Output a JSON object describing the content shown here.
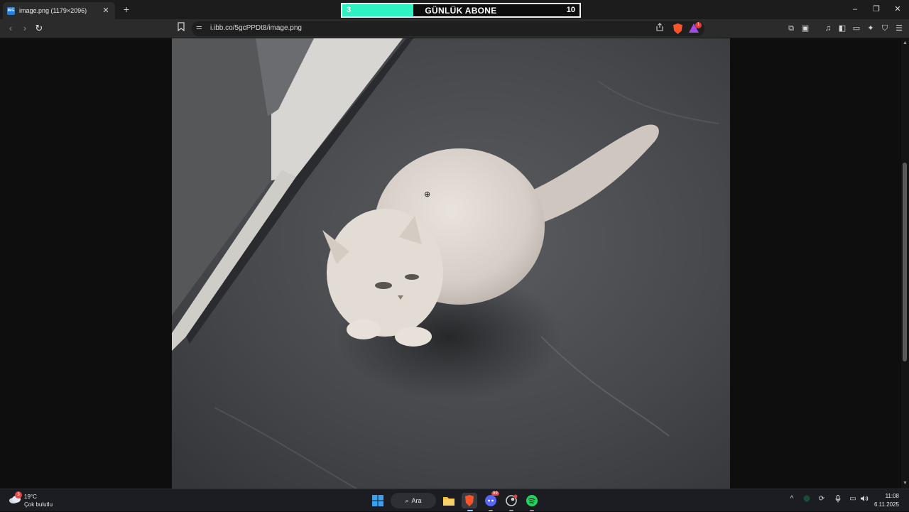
{
  "tab": {
    "title": "image.png (1179×2096)",
    "favicon_label": "IMG",
    "close": "✕",
    "new_tab": "+"
  },
  "subscriber_goal": {
    "current": "3",
    "label": "GÜNLÜK ABONE",
    "goal": "10",
    "progress": 0.3,
    "accent": "#2ef2c2"
  },
  "window_controls": {
    "minimize": "–",
    "restore": "❐",
    "close": "✕"
  },
  "nav": {
    "back": "‹",
    "forward": "›",
    "reload": "↻"
  },
  "address": {
    "site_info_icon": "⚌",
    "url": "i.ibb.co/5gcPPDt8/image.png"
  },
  "brave": {
    "shield_color": "#fb542b",
    "rewards_color": "#a34ae0",
    "rewards_badge": "1"
  },
  "toolbar_icons": [
    {
      "name": "extensions-icon",
      "glyph": "⧉"
    },
    {
      "name": "screenshot-icon",
      "glyph": "▣"
    },
    {
      "name": "media-icon",
      "glyph": "♫"
    },
    {
      "name": "sidebar-icon",
      "glyph": "◧"
    },
    {
      "name": "wallet-icon",
      "glyph": "▭"
    },
    {
      "name": "leo-ai-icon",
      "glyph": "✦"
    },
    {
      "name": "vpn-icon",
      "glyph": "⛉"
    },
    {
      "name": "menu-icon",
      "glyph": "☰"
    }
  ],
  "image": {
    "subject": "cat",
    "zoom_cursor": "⊕"
  },
  "taskbar": {
    "weather": {
      "temp": "19°C",
      "desc": "Çok bulutlu",
      "badge": "3"
    },
    "search_label": "Ara",
    "search_icon": "⌕",
    "discord_badge": "99",
    "tray": {
      "chevron": "^",
      "sync": "⟳",
      "mic": "🎙",
      "display": "▭",
      "volume": "🔊"
    },
    "time": "11:08",
    "date": "6.11.2025"
  }
}
